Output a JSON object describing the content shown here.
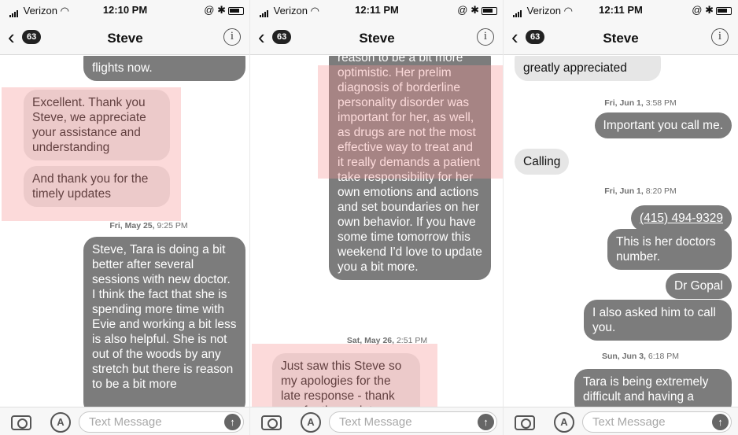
{
  "screens": [
    {
      "status": {
        "carrier": "Verizon",
        "time": "12:10 PM",
        "right": "@ ✱"
      },
      "nav": {
        "back_count": "63",
        "contact": "Steve",
        "info": "i"
      },
      "messages": {
        "m1": "flights now.",
        "m2": "Excellent.  Thank you Steve,  we appreciate your assistance and understanding",
        "m3": "And thank you for the timely updates",
        "stamp1_day": "Fri, May 25,",
        "stamp1_time": "9:25 PM",
        "m4": "Steve, Tara is doing a bit better after several sessions with new doctor. I think the fact that she is spending more time with Evie and working a bit less is also helpful. She is not out of the woods by any stretch but there is reason to be a bit more"
      },
      "input_placeholder": "Text Message"
    },
    {
      "status": {
        "carrier": "Verizon",
        "time": "12:11 PM",
        "right": "@ ✱"
      },
      "nav": {
        "back_count": "63",
        "contact": "Steve",
        "info": "i"
      },
      "messages": {
        "m1": "reason to be a bit more optimistic. Her prelim diagnosis of borderline personality disorder was important for her, as well, as drugs are not the most effective way to treat and it really demands a patient take responsibility for her own emotions and actions and set boundaries on her own behavior.  If you have some time tomorrow this weekend I'd love to update you a bit more.",
        "stamp1_day": "Sat, May 26,",
        "stamp1_time": "2:51 PM",
        "m2": "Just saw this Steve so my apologies for the late response  - thank you for the update"
      },
      "input_placeholder": "Text Message"
    },
    {
      "status": {
        "carrier": "Verizon",
        "time": "12:11 PM",
        "right": "@ ✱"
      },
      "nav": {
        "back_count": "63",
        "contact": "Steve",
        "info": "i"
      },
      "messages": {
        "m1": "greatly appreciated",
        "stamp1_day": "Fri, Jun 1,",
        "stamp1_time": "3:58 PM",
        "m2": "Important you call me.",
        "m3": "Calling",
        "stamp2_day": "Fri, Jun 1,",
        "stamp2_time": "8:20 PM",
        "m4": "(415) 494-9329",
        "m5": "This is her doctors number.",
        "m6": "Dr Gopal",
        "m7": "I also asked him to call you.",
        "stamp3_day": "Sun, Jun 3,",
        "stamp3_time": "6:18 PM",
        "m8": "Tara is being extremely difficult and having a"
      },
      "input_placeholder": "Text Message"
    }
  ],
  "icons": [
    "signal-icon",
    "wifi-icon",
    "battery-icon",
    "bluetooth-icon",
    "back-chevron-icon",
    "info-icon",
    "camera-icon",
    "app-store-icon",
    "send-arrow-icon"
  ],
  "colors": {
    "incoming_bubble": "#e6e6e6",
    "outgoing_bubble": "#7c7c7c",
    "highlight": "#f59696"
  }
}
